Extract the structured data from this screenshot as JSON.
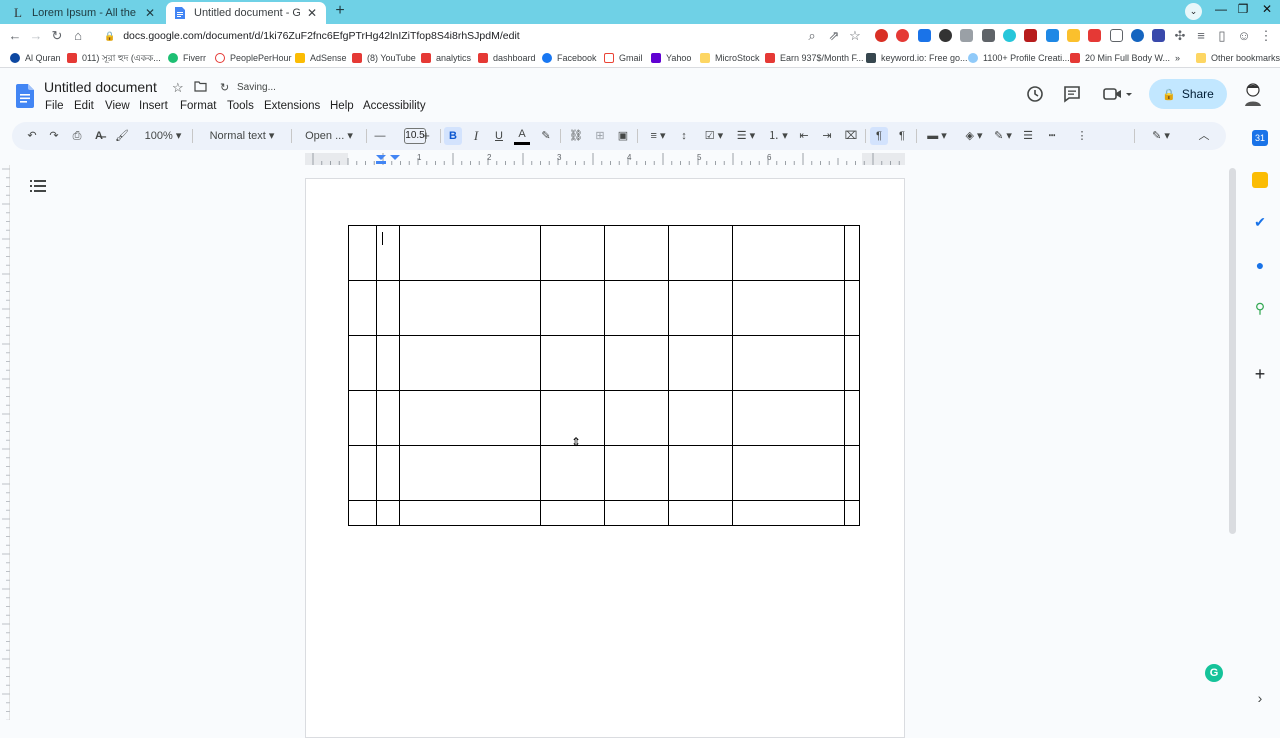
{
  "browser": {
    "tabs": [
      {
        "title": "Lorem Ipsum - All the facts - Lipsum",
        "active": false
      },
      {
        "title": "Untitled document - Google Docs",
        "active": true
      }
    ],
    "url": "docs.google.com/document/d/1ki76ZuF2fnc6EfgPTrHg42lnIZiTfop8S4i8rhSJpdM/edit",
    "bookmarks": [
      "Al Quran",
      "011) সূরা হুদ (একক...",
      "Fiverr",
      "PeoplePerHour",
      "AdSense",
      "(8) YouTube",
      "analytics",
      "dashboard",
      "Facebook",
      "Gmail",
      "Yahoo",
      "MicroStock",
      "Earn 937$/Month F...",
      "keyword.io: Free go...",
      "1100+ Profile Creati...",
      "20 Min Full Body W...",
      "Other bookmarks"
    ],
    "bookmark_overflow": "»"
  },
  "docs": {
    "title": "Untitled document",
    "status": "Saving...",
    "menus": [
      "File",
      "Edit",
      "View",
      "Insert",
      "Format",
      "Tools",
      "Extensions",
      "Help",
      "Accessibility"
    ],
    "share_label": "Share"
  },
  "format_toolbar": {
    "zoom": "100%",
    "style": "Normal text",
    "font": "Open ...",
    "font_size": "10.5"
  },
  "ruler": {
    "numbers": [
      "1",
      "2",
      "3",
      "4",
      "5",
      "6"
    ]
  },
  "table": {
    "rows": 6,
    "cols": 7,
    "cells": []
  },
  "colors": {
    "tab_strip": "#6fd1e6",
    "doc_background": "#f9fbfd",
    "toolbar": "#edf2fa",
    "share_button": "#c2e7ff",
    "docs_blue": "#4285f4",
    "grammarly": "#15c39a"
  }
}
